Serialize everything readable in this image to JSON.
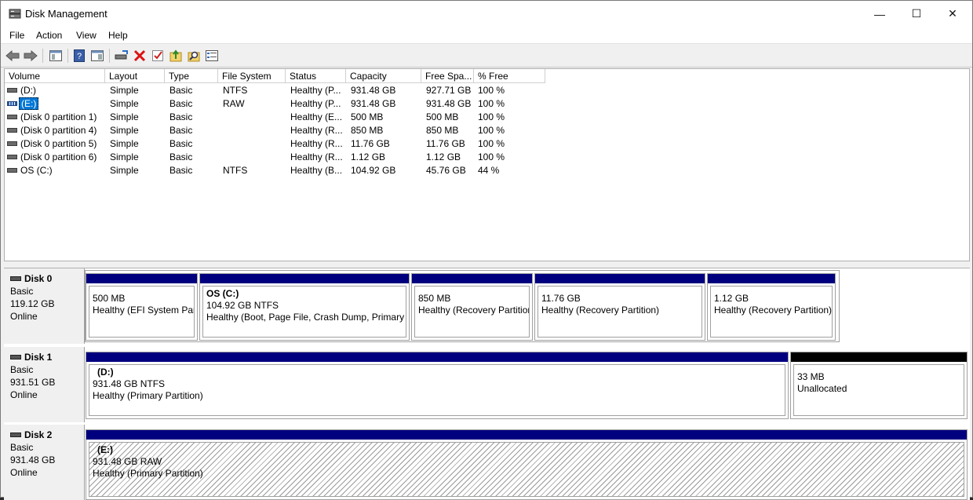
{
  "window": {
    "title": "Disk Management"
  },
  "window_controls": {
    "minimize": "—",
    "maximize": "☐",
    "close": "✕"
  },
  "menu": [
    "File",
    "Action",
    "View",
    "Help"
  ],
  "toolbar_icons": [
    "back-icon",
    "forward-icon",
    "console-tree-icon",
    "help-icon",
    "action-pane-icon",
    "connect-icon",
    "delete-icon",
    "check-icon",
    "folder-up-icon",
    "search-icon",
    "properties-icon"
  ],
  "volume_table": {
    "columns": [
      "Volume",
      "Layout",
      "Type",
      "File System",
      "Status",
      "Capacity",
      "Free Spa...",
      "% Free"
    ],
    "rows": [
      {
        "volume": "(D:)",
        "layout": "Simple",
        "type": "Basic",
        "fs": "NTFS",
        "status": "Healthy (P...",
        "capacity": "931.48 GB",
        "free": "927.71 GB",
        "pct": "100 %",
        "selected": false
      },
      {
        "volume": "(E:)",
        "layout": "Simple",
        "type": "Basic",
        "fs": "RAW",
        "status": "Healthy (P...",
        "capacity": "931.48 GB",
        "free": "931.48 GB",
        "pct": "100 %",
        "selected": true
      },
      {
        "volume": "(Disk 0 partition 1)",
        "layout": "Simple",
        "type": "Basic",
        "fs": "",
        "status": "Healthy (E...",
        "capacity": "500 MB",
        "free": "500 MB",
        "pct": "100 %",
        "selected": false
      },
      {
        "volume": "(Disk 0 partition 4)",
        "layout": "Simple",
        "type": "Basic",
        "fs": "",
        "status": "Healthy (R...",
        "capacity": "850 MB",
        "free": "850 MB",
        "pct": "100 %",
        "selected": false
      },
      {
        "volume": "(Disk 0 partition 5)",
        "layout": "Simple",
        "type": "Basic",
        "fs": "",
        "status": "Healthy (R...",
        "capacity": "11.76 GB",
        "free": "11.76 GB",
        "pct": "100 %",
        "selected": false
      },
      {
        "volume": "(Disk 0 partition 6)",
        "layout": "Simple",
        "type": "Basic",
        "fs": "",
        "status": "Healthy (R...",
        "capacity": "1.12 GB",
        "free": "1.12 GB",
        "pct": "100 %",
        "selected": false
      },
      {
        "volume": "OS (C:)",
        "layout": "Simple",
        "type": "Basic",
        "fs": "NTFS",
        "status": "Healthy (B...",
        "capacity": "104.92 GB",
        "free": "45.76 GB",
        "pct": "44 %",
        "selected": false
      }
    ]
  },
  "disks": [
    {
      "name": "Disk 0",
      "type": "Basic",
      "size": "119.12 GB",
      "state": "Online",
      "partitions": [
        {
          "title": "",
          "line1": "500 MB",
          "line2": "Healthy (EFI System Part"
        },
        {
          "title": "OS  (C:)",
          "line1": "104.92 GB NTFS",
          "line2": "Healthy (Boot, Page File, Crash Dump, Primary P"
        },
        {
          "title": "",
          "line1": "850 MB",
          "line2": "Healthy (Recovery Partitior"
        },
        {
          "title": "",
          "line1": "11.76 GB",
          "line2": "Healthy (Recovery Partition)"
        },
        {
          "title": "",
          "line1": "1.12 GB",
          "line2": "Healthy (Recovery Partition)"
        }
      ]
    },
    {
      "name": "Disk 1",
      "type": "Basic",
      "size": "931.51 GB",
      "state": "Online",
      "partitions": [
        {
          "title": "(D:)",
          "line1": "931.48 GB NTFS",
          "line2": "Healthy (Primary Partition)"
        },
        {
          "title": "",
          "line1": "33 MB",
          "line2": "Unallocated"
        }
      ]
    },
    {
      "name": "Disk 2",
      "type": "Basic",
      "size": "931.48 GB",
      "state": "Online",
      "partitions": [
        {
          "title": "(E:)",
          "line1": "931.48 GB RAW",
          "line2": "Healthy (Primary Partition)"
        }
      ]
    }
  ],
  "colors": {
    "partition_bar": "#00007f",
    "unallocated_bar": "#000000",
    "selection": "#0078d7"
  }
}
